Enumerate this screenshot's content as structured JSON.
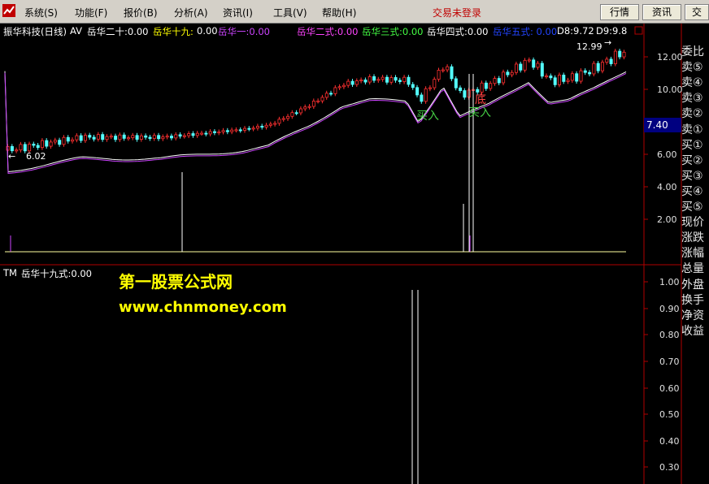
{
  "menubar": {
    "items": [
      "系统(S)",
      "功能(F)",
      "报价(B)",
      "分析(A)",
      "资讯(I)",
      "工具(V)",
      "帮助(H)"
    ],
    "trade_status": "交易未登录",
    "buttons": [
      "行情",
      "资讯",
      "交"
    ]
  },
  "top_panel": {
    "stock_title": "振华科技(日线)",
    "indicator": "AV",
    "legend": [
      {
        "text": "岳华二十:0.00",
        "color": "#ffffff"
      },
      {
        "text": "岳华十九:",
        "color": "#ffff00"
      },
      {
        "text": "0.00",
        "color": "#ffffff"
      },
      {
        "text": "岳华一:0.00",
        "color": "#cc44ff"
      },
      {
        "text": "岳华二式:0.00",
        "color": "#ff44ff"
      },
      {
        "text": "岳华三式:0.00",
        "color": "#44ff44"
      },
      {
        "text": "岳华四式:0.00",
        "color": "#ffffff"
      },
      {
        "text": "岳华五式: 0.00",
        "color": "#2244ff"
      },
      {
        "text": "D8:9.72",
        "color": "#ffffff"
      },
      {
        "text": "D9:9.8",
        "color": "#ffffff"
      }
    ],
    "y_ticks": [
      "12.00",
      "10.00",
      "8.00",
      "6.00",
      "4.00",
      "2.00"
    ],
    "current_price_tag": "7.40",
    "low_price_label": "6.02",
    "high_price_label": "12.99",
    "signals": [
      {
        "text": "买入",
        "color": "#44cc44"
      },
      {
        "text": "底",
        "color": "#ff4444"
      },
      {
        "text": "买入",
        "color": "#44cc44"
      }
    ]
  },
  "bottom_panel": {
    "indicator_name": "TM",
    "legend": "岳华十九式:0.00",
    "y_ticks": [
      "1.00",
      "0.90",
      "0.80",
      "0.70",
      "0.60",
      "0.50",
      "0.40",
      "0.30"
    ]
  },
  "watermark": {
    "line1": "第一股票公式网",
    "line2": "www.chnmoney.com"
  },
  "side_panel": [
    "委比",
    "卖⑤",
    "卖④",
    "卖③",
    "卖②",
    "卖①",
    "买①",
    "买②",
    "买③",
    "买④",
    "买⑤",
    "现价",
    "涨跌",
    "涨幅",
    "总量",
    "外盘",
    "换手",
    "净资",
    "收益"
  ],
  "colors": {
    "up": "#ff3030",
    "down": "#54ffff",
    "ma1": "#ffffff",
    "ma2": "#cc44ff",
    "axis": "#b00000",
    "price_tag_bg": "#000080"
  }
}
